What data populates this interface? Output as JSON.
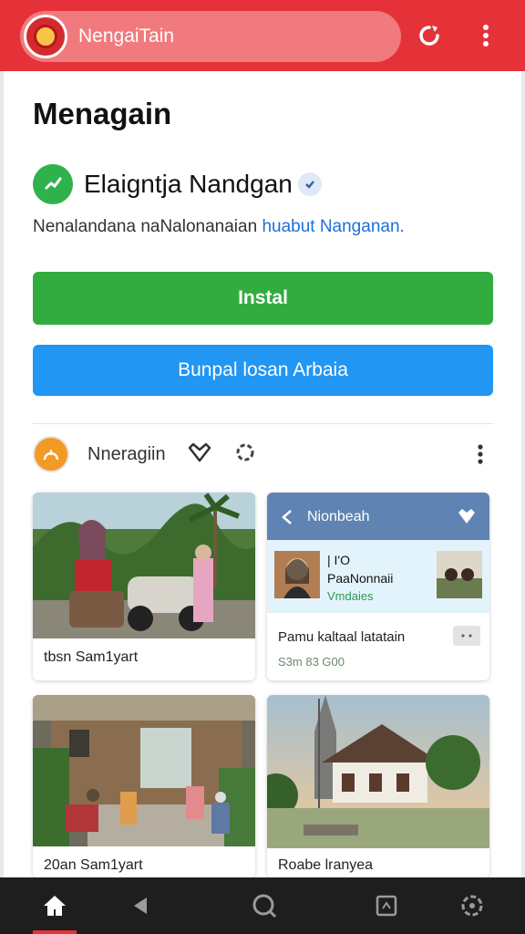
{
  "topbar": {
    "title": "NengaiTain",
    "icons": [
      "emblem-logo",
      "refresh-icon",
      "more-vert-icon"
    ]
  },
  "heading": "Menagain",
  "app": {
    "name": "Elaigntja Nandgan",
    "description_text": "Nenalandana naNalonanaian",
    "description_link": "huabut Nanganan."
  },
  "buttons": {
    "install": "Instal",
    "secondary": "Bunpal losan Arbaia"
  },
  "author": {
    "name": "Nneragiin"
  },
  "cards": [
    {
      "caption": "tbsn Sam1yart"
    },
    {
      "header": "Nionbeah",
      "line1": "|          I'O",
      "line2": "PaaNonnaii",
      "line3": "Vmdaies",
      "title": "Pamu kaltaal latatain",
      "price": "S3m 83 G00"
    },
    {
      "caption": "20an Sam1yart"
    },
    {
      "caption": "Roabe lranyea"
    }
  ],
  "colors": {
    "brand_red": "#e53238",
    "install_green": "#33ac3f",
    "secondary_blue": "#2196f3",
    "nav_dark": "#1e1e1e"
  },
  "bottomnav": {
    "items": [
      "home-icon",
      "back-icon",
      "search-icon",
      "library-icon",
      "settings-icon"
    ],
    "active": "home-icon"
  }
}
